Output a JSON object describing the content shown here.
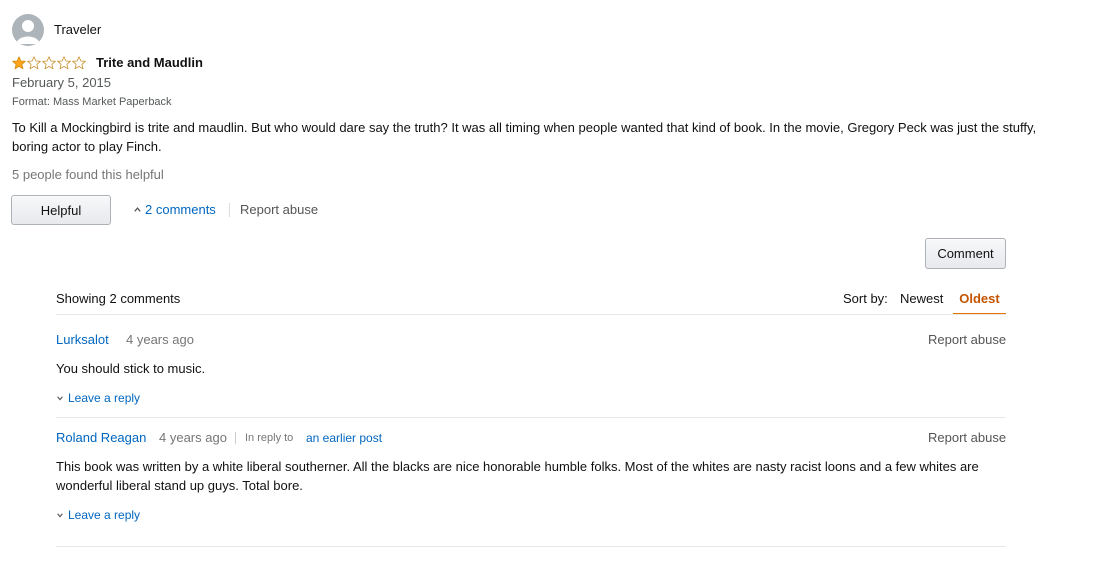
{
  "review": {
    "reviewer": "Traveler",
    "rating": 1,
    "rating_max": 5,
    "title": "Trite and Maudlin",
    "date": "February 5, 2015",
    "format": "Format: Mass Market Paperback",
    "body": "To Kill a Mockingbird is trite and maudlin. But who would dare say the truth? It was all timing when people wanted that kind of book. In the movie, Gregory Peck was just the stuffy, boring actor to play Finch.",
    "helpful_count_text": "5 people found this helpful",
    "helpful_label": "Helpful",
    "comments_toggle": "2 comments",
    "report_abuse": "Report abuse",
    "star_color": "#ffa41c"
  },
  "comments_section": {
    "comment_button": "Comment",
    "showing": "Showing 2 comments",
    "sort_label": "Sort by:",
    "sort_options": [
      "Newest",
      "Oldest"
    ],
    "sort_selected": "Oldest",
    "comments": [
      {
        "author": "Lurksalot",
        "time": "4 years ago",
        "report": "Report abuse",
        "text": "You should stick to music.",
        "leave_reply": "Leave a reply"
      },
      {
        "author": "Roland Reagan",
        "time": "4 years ago",
        "in_reply_label": "In reply to",
        "in_reply_link": "an earlier post",
        "report": "Report abuse",
        "text": "This book was written by a white liberal southerner. All the blacks are nice honorable humble folks. Most of the whites are nasty racist loons and a few whites are wonderful liberal stand up guys. Total bore.",
        "leave_reply": "Leave a reply"
      }
    ]
  }
}
